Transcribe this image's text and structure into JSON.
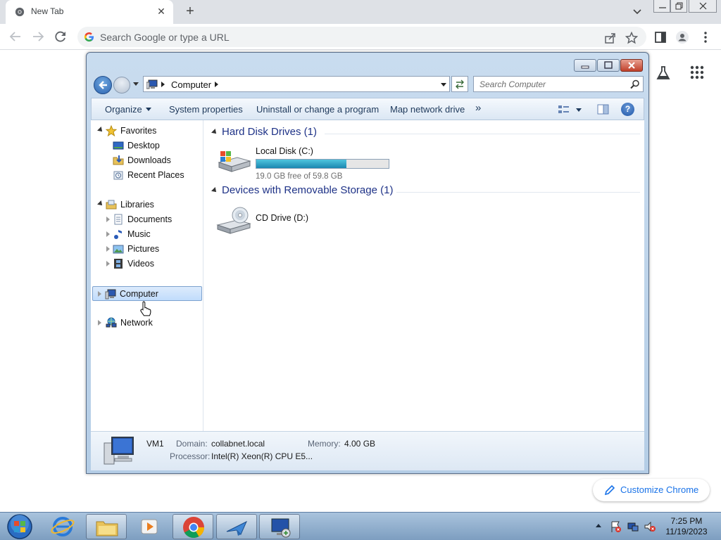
{
  "browser": {
    "tab": {
      "title": "New Tab"
    },
    "omnibox": {
      "placeholder": "Search Google or type a URL"
    },
    "customize_label": "Customize Chrome"
  },
  "explorer": {
    "breadcrumb": "Computer",
    "search_placeholder": "Search Computer",
    "commands": {
      "organize": "Organize",
      "system_properties": "System properties",
      "uninstall": "Uninstall or change a program",
      "map_drive": "Map network drive",
      "overflow": "»"
    },
    "nav": {
      "favorites": "Favorites",
      "desktop": "Desktop",
      "downloads": "Downloads",
      "recent": "Recent Places",
      "libraries": "Libraries",
      "documents": "Documents",
      "music": "Music",
      "pictures": "Pictures",
      "videos": "Videos",
      "computer": "Computer",
      "network": "Network"
    },
    "groups": {
      "hdd": "Hard Disk Drives (1)",
      "removable": "Devices with Removable Storage (1)"
    },
    "drives": {
      "c": {
        "name": "Local Disk (C:)",
        "free": "19.0 GB free of 59.8 GB",
        "used_fraction": 0.68
      },
      "d": {
        "name": "CD Drive (D:)"
      }
    },
    "details": {
      "computer_name": "VM1",
      "domain_label": "Domain:",
      "domain_value": "collabnet.local",
      "memory_label": "Memory:",
      "memory_value": "4.00 GB",
      "processor_label": "Processor:",
      "processor_value": "Intel(R) Xeon(R) CPU E5..."
    }
  },
  "taskbar": {
    "time": "7:25 PM",
    "date": "11/19/2023"
  },
  "colors": {
    "chrome_tabstrip": "#dee1e6",
    "chrome_accent": "#1a73e8",
    "explorer_heading": "#1e3287",
    "taskbar": "#8fb0d0"
  }
}
